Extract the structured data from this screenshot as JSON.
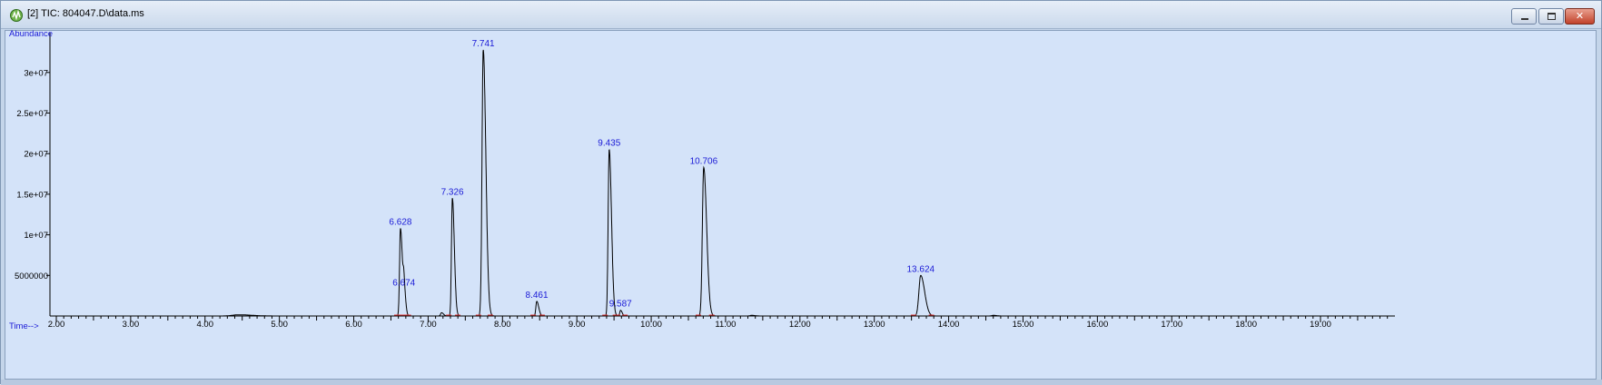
{
  "window": {
    "title": "[2] TIC: 804047.D\\data.ms",
    "icon": "chromatogram-app-icon",
    "controls": [
      "minimize",
      "maximize",
      "close"
    ],
    "close_glyph": "✕"
  },
  "chart_data": {
    "type": "line",
    "title": "",
    "ylabel": "Abundance",
    "xlabel": "Time-->",
    "xlim": [
      1.9,
      20.0
    ],
    "ylim": [
      0,
      34500000
    ],
    "x_ticks": [
      2.0,
      3.0,
      4.0,
      5.0,
      6.0,
      7.0,
      8.0,
      9.0,
      10.0,
      11.0,
      12.0,
      13.0,
      14.0,
      15.0,
      16.0,
      17.0,
      18.0,
      19.0
    ],
    "x_tick_labels": [
      "2.00",
      "3.00",
      "4.00",
      "5.00",
      "6.00",
      "7.00",
      "8.00",
      "9.00",
      "10.00",
      "11.00",
      "12.00",
      "13.00",
      "14.00",
      "15.00",
      "16.00",
      "17.00",
      "18.00",
      "19.00"
    ],
    "y_ticks": [
      5000000,
      10000000,
      15000000,
      20000000,
      25000000,
      30000000
    ],
    "y_tick_labels": [
      "5000000",
      "1e+07",
      "1.5e+07",
      "2e+07",
      "2.5e+07",
      "3e+07"
    ],
    "grid": false,
    "line_color": "#000000",
    "label_color": "#1a1ad6",
    "baseline_marker_color": "#e03030",
    "series": [
      {
        "peaks": [
          {
            "rt": 6.628,
            "label": "6.628",
            "height": 10800000,
            "width": 0.012
          },
          {
            "rt": 6.674,
            "label": "6.674",
            "height": 3300000,
            "width": 0.01
          },
          {
            "rt": 7.326,
            "label": "7.326",
            "height": 14500000,
            "width": 0.012
          },
          {
            "rt": 7.741,
            "label": "7.741",
            "height": 32800000,
            "width": 0.016
          },
          {
            "rt": 8.461,
            "label": "8.461",
            "height": 1800000,
            "width": 0.012
          },
          {
            "rt": 9.435,
            "label": "9.435",
            "height": 20500000,
            "width": 0.014
          },
          {
            "rt": 9.587,
            "label": "9.587",
            "height": 700000,
            "width": 0.01
          },
          {
            "rt": 10.706,
            "label": "10.706",
            "height": 18300000,
            "width": 0.018
          },
          {
            "rt": 13.624,
            "label": "13.624",
            "height": 5000000,
            "width": 0.024
          }
        ],
        "minor_bumps": [
          {
            "rt": 4.45,
            "height": 150000,
            "width": 0.08
          },
          {
            "rt": 7.18,
            "height": 400000,
            "width": 0.012
          },
          {
            "rt": 11.35,
            "height": 80000,
            "width": 0.02
          },
          {
            "rt": 14.6,
            "height": 80000,
            "width": 0.02
          }
        ]
      }
    ]
  }
}
